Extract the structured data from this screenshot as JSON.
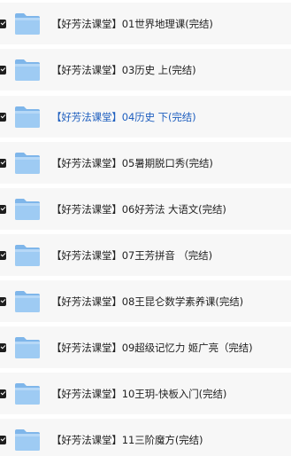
{
  "files": [
    {
      "name": "【好芳法课堂】01世界地理课(完结)",
      "active": false
    },
    {
      "name": "【好芳法课堂】03历史 上(完结)",
      "active": false
    },
    {
      "name": "【好芳法课堂】04历史 下(完结)",
      "active": true
    },
    {
      "name": "【好芳法课堂】05暑期脱口秀(完结)",
      "active": false
    },
    {
      "name": "【好芳法课堂】06好芳法 大语文(完结)",
      "active": false
    },
    {
      "name": "【好芳法课堂】07王芳拼音 （完结)",
      "active": false
    },
    {
      "name": "【好芳法课堂】08王昆仑数学素养课(完结)",
      "active": false
    },
    {
      "name": "【好芳法课堂】09超级记忆力 姬广亮（完结)",
      "active": false
    },
    {
      "name": "【好芳法课堂】10王玥-快板入门(完结)",
      "active": false
    },
    {
      "name": "【好芳法课堂】11三阶魔方(完结)",
      "active": false
    }
  ],
  "colors": {
    "row_background": "#f7f7f7",
    "text": "#222222",
    "active_text": "#1f5fbf",
    "folder_front": "#9ecbf3",
    "folder_back": "#7fb6ea",
    "checkbox": "#1e1e1e"
  },
  "icons": {
    "folder": "folder-icon",
    "checkbox": "checkbox-checked-icon"
  }
}
